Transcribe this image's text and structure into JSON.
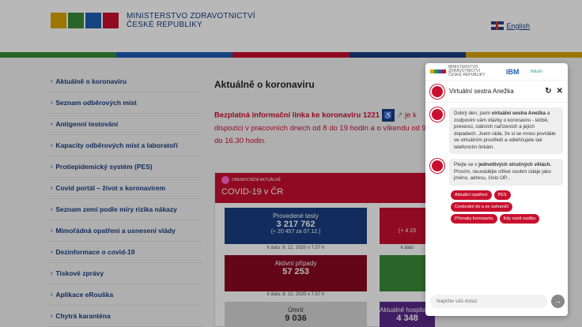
{
  "header": {
    "org_line1": "MINISTERSTVO ZDRAVOTNICTVÍ",
    "org_line2": "ČESKÉ REPUBLIKY",
    "lang_label": "English"
  },
  "colors": {
    "brand_red": "#c8102e",
    "brand_blue": "#1a3e82",
    "bar": [
      "#3a8d3a",
      "#1f5eb5",
      "#c8102e",
      "#1a3e82",
      "#d9a400"
    ]
  },
  "sidebar": {
    "items": [
      {
        "label": "Aktuálně o koronaviru"
      },
      {
        "label": "Seznam odběrových míst"
      },
      {
        "label": "Antigenní testování"
      },
      {
        "label": "Kapacity odběrových míst a laboratoří"
      },
      {
        "label": "Protiepidemický systém (PES)"
      },
      {
        "label": "Covid portál – život s koronavirem"
      },
      {
        "label": "Seznam zemí podle míry rizika nákazy"
      },
      {
        "label": "Mimořádná opatření a usnesení vlády"
      },
      {
        "label": "Dezinformace o covid-19"
      },
      {
        "label": "Tiskové zprávy"
      },
      {
        "label": "Aplikace eRouška"
      },
      {
        "label": "Chytrá karanténa"
      }
    ]
  },
  "main": {
    "title": "Aktuálně o koronaviru",
    "hotline_bold": "Bezplatná informační linka ke koronaviru 1221",
    "hotline_je": "je",
    "hotline_rest": "k dispozici v pracovních dnech od 8 do 19 hodin a o víkendu od 9 do 16.30 hodin."
  },
  "covid": {
    "badge_small": "ONEMOCNĚNÍ AKTUÁLNĚ",
    "title": "COVID-19 v ČR",
    "tiles": [
      {
        "label": "Provedené testy",
        "value": "3 217 762",
        "sub": "(+ 20 457 za 07.12.)",
        "date": "k datu: 8. 12. 2020 v 7.57 h",
        "color": "#1a3e82"
      },
      {
        "label": "Aktivní případy",
        "value": "57 253",
        "sub": "",
        "date": "k datu: 8. 12. 2020 v 7.57 h",
        "color": "#8a0b22"
      },
      {
        "label": "Úmrtí",
        "value": "9 036",
        "sub": "",
        "date": "",
        "color": "#d6d6d6"
      }
    ],
    "right_sub": "(+ 4 23",
    "right_date": "k datu",
    "right_bottom_label": "Aktuálně hospitalizovaní",
    "right_bottom_value": "4 348"
  },
  "chat": {
    "top_org": "MINISTERSTVO ZDRAVOTNICTVÍ ČESKÉ REPUBLIKY",
    "ibm": "IBM",
    "mluvii": "mluvii",
    "name": "Virtuální sestra Anežka",
    "msg1_pre": "Dobrý den, jsem ",
    "msg1_bold": "virtuální sestra Anežka",
    "msg1_post": " a zodpovím vám otázky o koronaviru - léčbě, prevenci, státních nařízeních a jejich dopadech. Jsem ráda, že si se mnou povídáte ve virtuálním prostředí a odlehčujete tak telefonním linkám.",
    "msg2_pre": "Ptejte se v ",
    "msg2_bold": "jednotlivých stručných větách.",
    "msg2_post": "Prosím, neuvádějte citlivé osobní údaje jako jméno, adresu, číslo OP...",
    "chips": [
      "Aktuální opatření",
      "PES",
      "Cestování do a ze zahraničí",
      "Příznaky koronaviru",
      "Kdy nosit roušku"
    ],
    "input_placeholder": "Napište váš dotaz"
  }
}
